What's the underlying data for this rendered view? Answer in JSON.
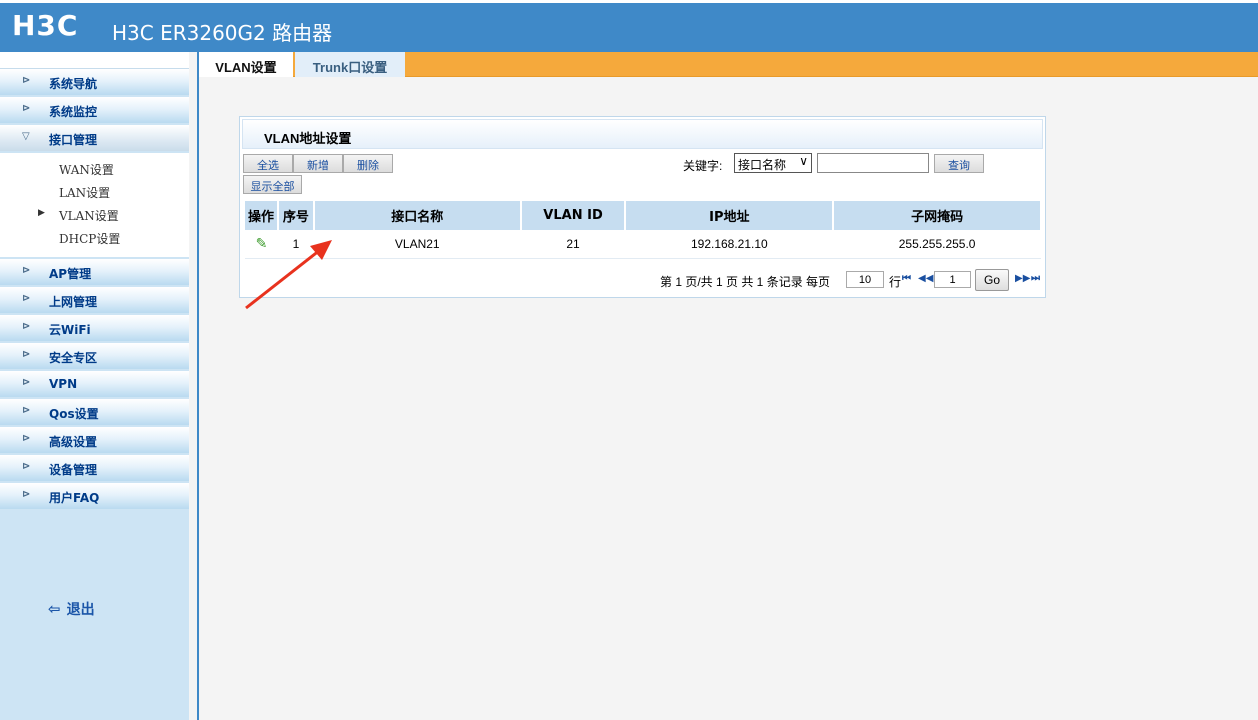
{
  "header": {
    "logo": "H3C",
    "title": "H3C ER3260G2 路由器"
  },
  "sidebar": {
    "items": [
      {
        "label": "系统导航"
      },
      {
        "label": "系统监控"
      },
      {
        "label": "接口管理"
      },
      {
        "label": "AP管理"
      },
      {
        "label": "上网管理"
      },
      {
        "label": "云WiFi"
      },
      {
        "label": "安全专区"
      },
      {
        "label": "VPN"
      },
      {
        "label": "Qos设置"
      },
      {
        "label": "高级设置"
      },
      {
        "label": "设备管理"
      },
      {
        "label": "用户FAQ"
      }
    ],
    "submenu": [
      {
        "label": "WAN设置"
      },
      {
        "label": "LAN设置"
      },
      {
        "label": "VLAN设置",
        "active": true
      },
      {
        "label": "DHCP设置"
      }
    ],
    "logout": "退出"
  },
  "tabs": {
    "vlan": "VLAN设置",
    "trunk": "Trunk口设置"
  },
  "panel": {
    "title": "VLAN地址设置",
    "buttons": {
      "select_all": "全选",
      "add": "新增",
      "delete": "删除",
      "show_all": "显示全部",
      "query": "查询"
    },
    "keyword_label": "关键字:",
    "keyword_select": "接口名称",
    "keyword_value": ""
  },
  "table": {
    "headers": [
      "操作",
      "序号",
      "接口名称",
      "VLAN ID",
      "IP地址",
      "子网掩码"
    ],
    "rows": [
      {
        "index": "1",
        "name": "VLAN21",
        "vlan_id": "21",
        "ip": "192.168.21.10",
        "mask": "255.255.255.0"
      }
    ]
  },
  "pager": {
    "summary": "第 1 页/共 1 页 共 1 条记录 每页",
    "per_page": "10",
    "row_label": "行",
    "page": "1",
    "go": "Go"
  },
  "colors": {
    "header_blue": "#3f89c8",
    "tab_orange": "#f5a93c",
    "annotation_arrow": "#e8321e"
  }
}
